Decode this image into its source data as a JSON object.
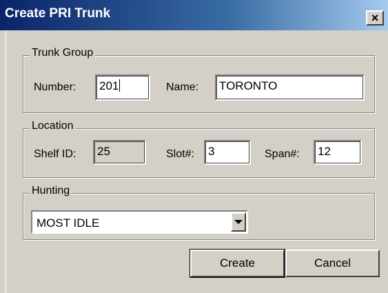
{
  "window": {
    "title": "Create PRI Trunk",
    "close_icon_glyph": "×",
    "close_icon": "close-icon"
  },
  "trunk_group": {
    "legend": "Trunk Group",
    "number_label": "Number:",
    "number_value": "201",
    "name_label": "Name:",
    "name_value": "TORONTO"
  },
  "location": {
    "legend": "Location",
    "shelf_label": "Shelf ID:",
    "shelf_value": "25",
    "slot_label": "Slot#:",
    "slot_value": "3",
    "span_label": "Span#:",
    "span_value": "12"
  },
  "hunting": {
    "legend": "Hunting",
    "selected": "MOST IDLE",
    "dropdown_icon": "chevron-down-icon"
  },
  "actions": {
    "create_label": "Create",
    "cancel_label": "Cancel"
  },
  "colors": {
    "title_gradient_start": "#0a246a",
    "title_gradient_end": "#a6caf0",
    "face": "#d4d0c8"
  }
}
